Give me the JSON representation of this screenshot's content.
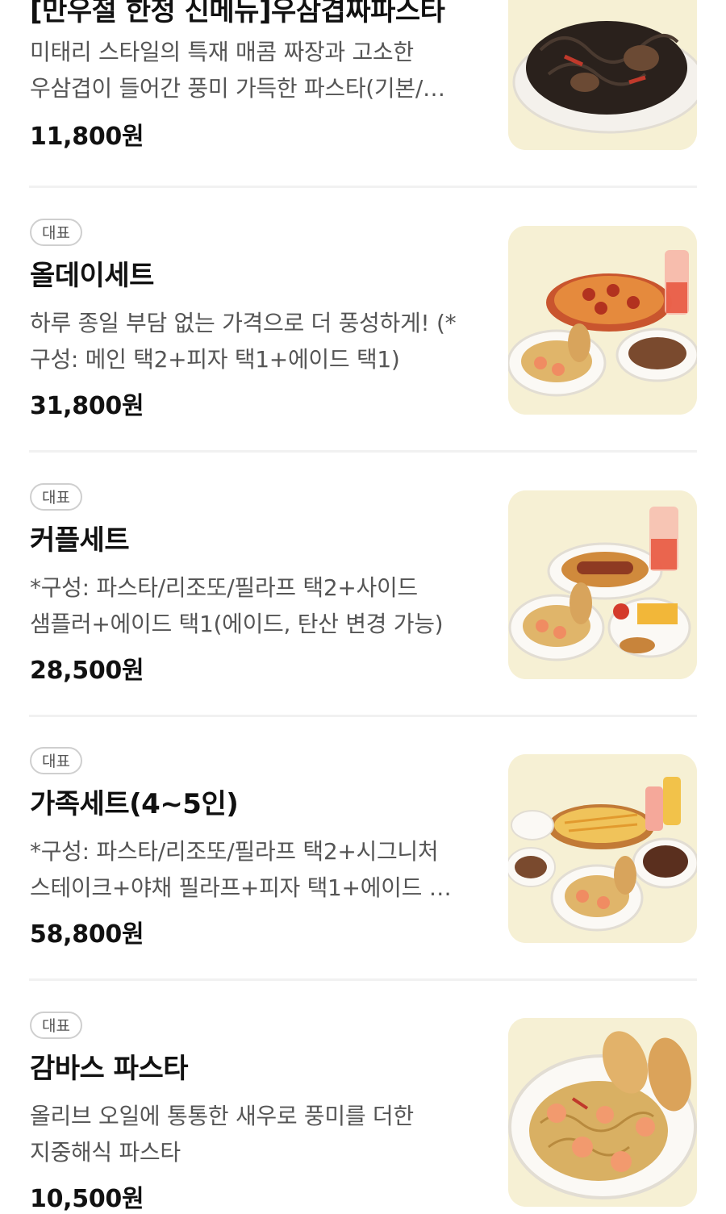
{
  "items": [
    {
      "badge": "",
      "name": "[만우절 한정 신메뉴]우삼겹짜파스타",
      "desc": "미태리 스타일의 특재 매콤 짜장과 고소한 우삼겹이 들어간 풍미 가득한 파스타(기본/…",
      "price": "11,800원",
      "image": "jjajang-pasta-photo"
    },
    {
      "badge": "대표",
      "name": "올데이세트",
      "desc": "하루 종일 부담 없는 가격으로 더 풍성하게! (*구성: 메인 택2+피자 택1+에이드 택1)",
      "price": "31,800원",
      "image": "allday-set-photo"
    },
    {
      "badge": "대표",
      "name": "커플세트",
      "desc": "*구성: 파스타/리조또/필라프 택2+사이드 샘플러+에이드 택1(에이드, 탄산 변경 가능)",
      "price": "28,500원",
      "image": "couple-set-photo"
    },
    {
      "badge": "대표",
      "name": "가족세트(4~5인)",
      "desc": "*구성: 파스타/리조또/필라프 택2+시그니처 스테이크+야채 필라프+피자 택1+에이드 …",
      "price": "58,800원",
      "image": "family-set-photo"
    },
    {
      "badge": "대표",
      "name": "감바스 파스타",
      "desc": "올리브 오일에 통통한 새우로 풍미를 더한 지중해식 파스타",
      "price": "10,500원",
      "image": "gambas-pasta-photo"
    }
  ]
}
